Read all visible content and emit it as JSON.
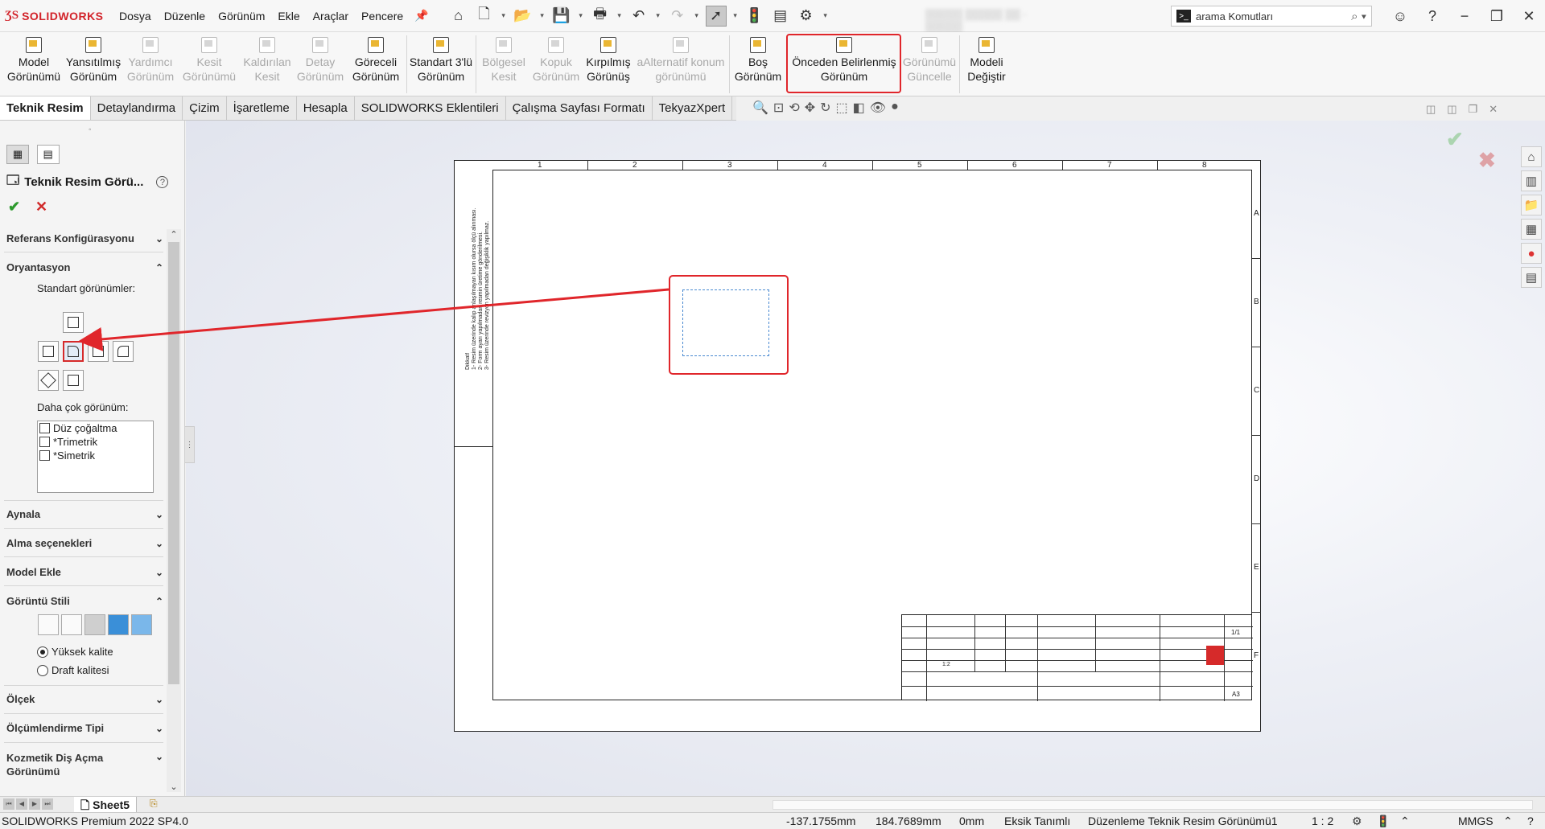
{
  "app": {
    "brand_ds": "ƷS",
    "brand_name": "SOLIDWORKS",
    "menus": [
      "Dosya",
      "Düzenle",
      "Görünüm",
      "Ekle",
      "Araçlar",
      "Pencere"
    ],
    "search_placeholder": "arama Komutları"
  },
  "commands": [
    {
      "line1": "Model",
      "line2": "Görünümü",
      "enabled": true
    },
    {
      "line1": "Yansıtılmış",
      "line2": "Görünüm",
      "enabled": true
    },
    {
      "line1": "Yardımcı",
      "line2": "Görünüm",
      "enabled": false
    },
    {
      "line1": "Kesit",
      "line2": "Görünümü",
      "enabled": false
    },
    {
      "line1": "Kaldırılan",
      "line2": "Kesit",
      "enabled": false
    },
    {
      "line1": "Detay",
      "line2": "Görünüm",
      "enabled": false
    },
    {
      "line1": "Göreceli",
      "line2": "Görünüm",
      "enabled": true
    },
    {
      "line1": "Standart 3'lü",
      "line2": "Görünüm",
      "enabled": true
    },
    {
      "line1": "Bölgesel",
      "line2": "Kesit",
      "enabled": false
    },
    {
      "line1": "Kopuk",
      "line2": "Görünüm",
      "enabled": false
    },
    {
      "line1": "Kırpılmış",
      "line2": "Görünüş",
      "enabled": true
    },
    {
      "line1": "aAlternatif konum",
      "line2": "görünümü",
      "enabled": false
    },
    {
      "line1": "Boş",
      "line2": "Görünüm",
      "enabled": true
    },
    {
      "line1": "Önceden Belirlenmiş",
      "line2": "Görünüm",
      "enabled": true
    },
    {
      "line1": "Görünümü",
      "line2": "Güncelle",
      "enabled": false
    },
    {
      "line1": "Modeli",
      "line2": "Değiştir",
      "enabled": true
    }
  ],
  "tabs": [
    "Teknik Resim",
    "Detaylandırma",
    "Çizim",
    "İşaretleme",
    "Hesapla",
    "SOLIDWORKS Eklentileri",
    "Çalışma Sayfası Formatı",
    "TekyazXpert"
  ],
  "panel": {
    "title": "Teknik Resim Görü...",
    "sections": {
      "ref_config": "Referans Konfigürasyonu",
      "orientation": "Oryantasyon",
      "std_views": "Standart görünümler:",
      "more_views": "Daha çok görünüm:",
      "mirror": "Aynala",
      "import_options": "Alma seçenekleri",
      "add_model": "Model Ekle",
      "display_style": "Görüntü Stili",
      "scale": "Ölçek",
      "dim_type": "Ölçümlendirme Tipi",
      "cosmetic_thread_1": "Kozmetik Diş Açma",
      "cosmetic_thread_2": "Görünümü"
    },
    "more_views_list": [
      "Düz çoğaltma",
      "*Trimetrik",
      "*Simetrik"
    ],
    "quality": {
      "high": "Yüksek kalite",
      "draft": "Draft kalitesi",
      "selected": "high"
    }
  },
  "sheet": {
    "columns": [
      "1",
      "2",
      "3",
      "4",
      "5",
      "6",
      "7",
      "8"
    ],
    "rows": [
      "A",
      "B",
      "C",
      "D",
      "E",
      "F"
    ],
    "size_label": "A3",
    "sheet_no": "1/1",
    "scale": "1:2"
  },
  "sheet_tab": "Sheet5",
  "status": {
    "product": "SOLIDWORKS Premium 2022 SP4.0",
    "x": "-137.1755mm",
    "y": "184.7689mm",
    "z": "0mm",
    "state": "Eksik Tanımlı",
    "mode": "Düzenleme Teknik Resim Görünümü1",
    "scale": "1 : 2",
    "units": "MMGS"
  },
  "colors": {
    "highlight": "#e0262b",
    "accent": "#d2232a"
  }
}
